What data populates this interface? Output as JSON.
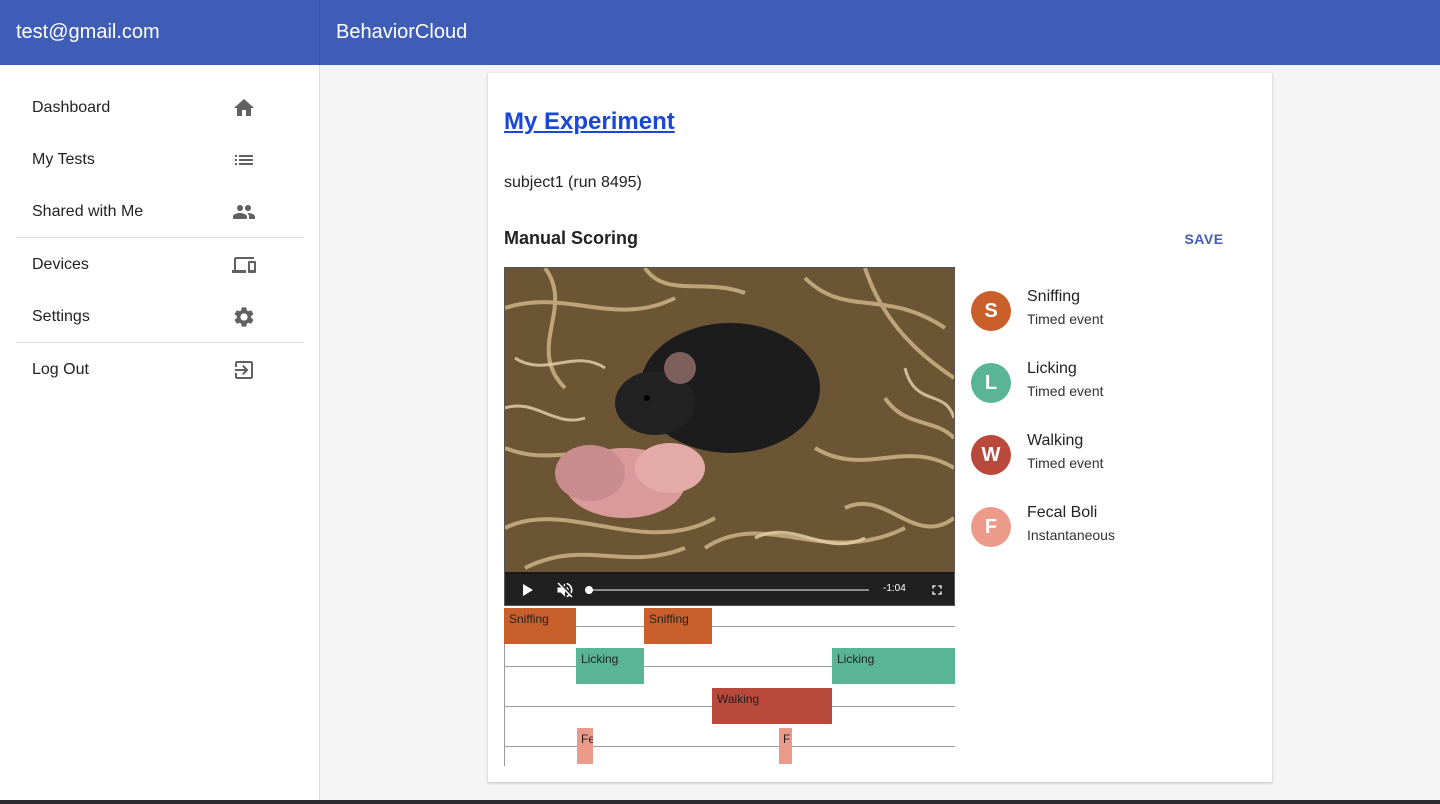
{
  "header": {
    "user_email": "test@gmail.com",
    "app_title": "BehaviorCloud"
  },
  "sidebar": {
    "items": [
      {
        "label": "Dashboard",
        "icon": "home-icon"
      },
      {
        "label": "My Tests",
        "icon": "list-icon"
      },
      {
        "label": "Shared with Me",
        "icon": "people-icon"
      },
      {
        "label": "Devices",
        "icon": "devices-icon"
      },
      {
        "label": "Settings",
        "icon": "gear-icon"
      },
      {
        "label": "Log Out",
        "icon": "logout-icon"
      }
    ]
  },
  "main": {
    "experiment_link": "My Experiment",
    "subject": "subject1 (run 8495)",
    "section_title": "Manual Scoring",
    "save_label": "SAVE",
    "video": {
      "time_remaining": "-1:04",
      "progress": 0.0
    },
    "behaviors": [
      {
        "initial": "S",
        "name": "Sniffing",
        "type": "Timed event",
        "color": "#c95f2a"
      },
      {
        "initial": "L",
        "name": "Licking",
        "type": "Timed event",
        "color": "#5ab597"
      },
      {
        "initial": "W",
        "name": "Walking",
        "type": "Timed event",
        "color": "#b9493a"
      },
      {
        "initial": "F",
        "name": "Fecal Boli",
        "type": "Instantaneous",
        "color": "#ec9a8a"
      }
    ],
    "timeline_labels": {
      "sniffing_1": "Sniffing",
      "sniffing_2": "Sniffing",
      "licking_1": "Licking",
      "licking_2": "Licking",
      "walking_1": "Walking",
      "fecal_1": "Fe",
      "fecal_2": "F"
    }
  },
  "colors": {
    "accent": "#3f5db7",
    "link": "#1a47d9"
  }
}
